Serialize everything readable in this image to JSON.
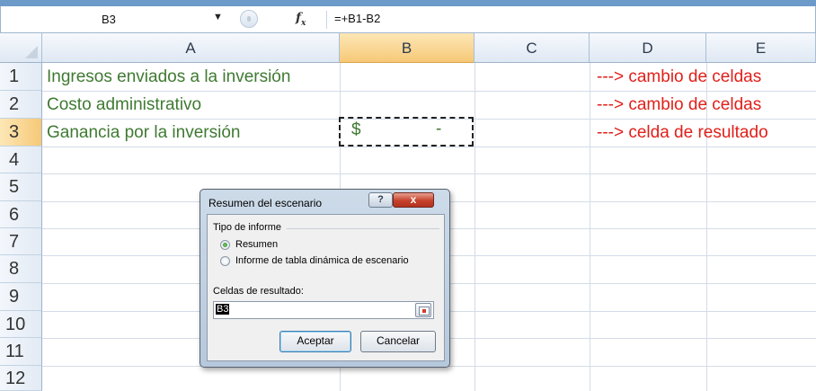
{
  "formula_bar": {
    "cell_ref": "B3",
    "dropdown_glyph": "▼",
    "fx_label": "fx",
    "formula": "=+B1-B2"
  },
  "columns": [
    "A",
    "B",
    "C",
    "D",
    "E"
  ],
  "selected_column": "B",
  "rows": [
    "1",
    "2",
    "3",
    "4",
    "5",
    "6",
    "7",
    "8",
    "9",
    "10",
    "11",
    "12"
  ],
  "selected_row": "3",
  "cells": {
    "A1": "Ingresos enviados a la inversión",
    "A2": "Costo administrativo",
    "A3": "Ganancia por la inversión",
    "B3_symbol": "$",
    "B3_value": "-",
    "D1": "---> cambio de celdas",
    "D2": "---> cambio de celdas",
    "D3": "---> celda de resultado"
  },
  "colors": {
    "label_green": "#3f7a32",
    "annotation_red": "#e0201a",
    "selected_header": "#f6c977"
  },
  "dialog": {
    "title": "Resumen del escenario",
    "help_label": "?",
    "close_label": "x",
    "group_label": "Tipo de informe",
    "option_summary": "Resumen",
    "option_pivot": "Informe de tabla dinámica de escenario",
    "selected_option": "Resumen",
    "result_cells_label": "Celdas de resultado:",
    "result_cells_value": "B3",
    "accept_label": "Aceptar",
    "cancel_label": "Cancelar"
  }
}
